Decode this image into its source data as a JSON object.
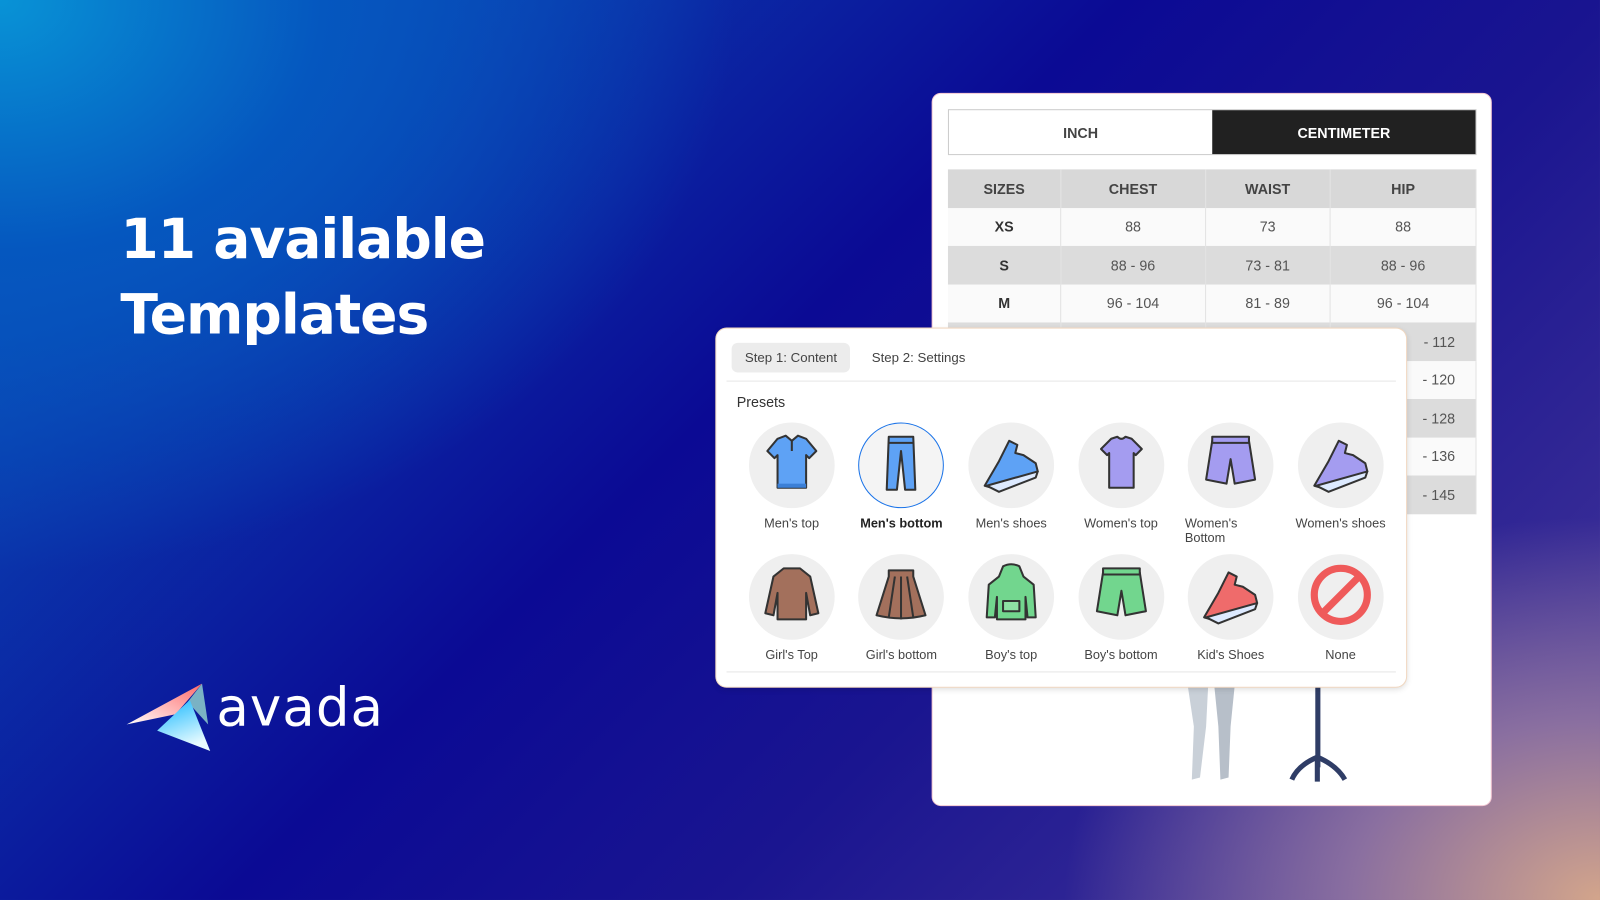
{
  "headline": {
    "line1": "11 available",
    "line2": "Templates"
  },
  "logo": {
    "text": "avada"
  },
  "size_chart": {
    "units": [
      {
        "label": "INCH",
        "active": false
      },
      {
        "label": "CENTIMETER",
        "active": true
      }
    ],
    "columns": [
      "SIZES",
      "CHEST",
      "WAIST",
      "HIP"
    ],
    "rows": [
      [
        "XS",
        "88",
        "73",
        "88"
      ],
      [
        "S",
        "88 - 96",
        "73 - 81",
        "88 - 96"
      ],
      [
        "M",
        "96 - 104",
        "81 - 89",
        "96 - 104"
      ]
    ],
    "partial_hip": [
      "- 112",
      "- 120",
      "- 128",
      "- 136",
      "- 145"
    ]
  },
  "panel": {
    "tabs": [
      {
        "label": "Step 1: Content",
        "active": true
      },
      {
        "label": "Step 2: Settings",
        "active": false
      }
    ],
    "presets_label": "Presets",
    "presets": [
      {
        "label": "Men's top",
        "icon": "polo-shirt-icon",
        "color": "#5ea2f5",
        "selected": false
      },
      {
        "label": "Men's bottom",
        "icon": "jeans-icon",
        "color": "#5ea2f5",
        "selected": true
      },
      {
        "label": "Men's shoes",
        "icon": "sneaker-icon",
        "color": "#5ea2f5",
        "selected": false
      },
      {
        "label": "Women's top",
        "icon": "tshirt-icon",
        "color": "#a49cf0",
        "selected": false
      },
      {
        "label": "Women's Bottom",
        "icon": "shorts-icon",
        "color": "#a49cf0",
        "selected": false
      },
      {
        "label": "Women's shoes",
        "icon": "sneaker-icon",
        "color": "#a49cf0",
        "selected": false
      },
      {
        "label": "Girl's Top",
        "icon": "sweater-icon",
        "color": "#a3705c",
        "selected": false
      },
      {
        "label": "Girl's bottom",
        "icon": "skirt-icon",
        "color": "#a3705c",
        "selected": false
      },
      {
        "label": "Boy's top",
        "icon": "hoodie-icon",
        "color": "#72d68e",
        "selected": false
      },
      {
        "label": "Boy's bottom",
        "icon": "shorts-icon",
        "color": "#72d68e",
        "selected": false
      },
      {
        "label": "Kid's Shoes",
        "icon": "sneaker-icon",
        "color": "#ef6b6b",
        "selected": false
      },
      {
        "label": "None",
        "icon": "no-sign-icon",
        "color": "#ef5a5a",
        "selected": false
      }
    ]
  }
}
